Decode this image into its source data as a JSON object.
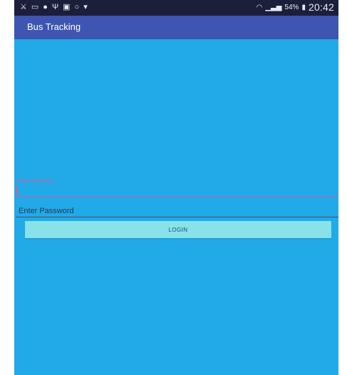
{
  "status_bar": {
    "left_icons": [
      "notification-icon",
      "cast-icon",
      "vpn-icon",
      "usb-icon",
      "gallery-icon",
      "whatsapp-icon",
      "dropdown-icon"
    ],
    "wifi_icon": "wifi-icon",
    "signal_icon": "signal-icon",
    "battery_percent": "54%",
    "battery_icon": "battery-icon",
    "time": "20:42"
  },
  "app_bar": {
    "title": "Bus Tracking"
  },
  "login_form": {
    "username_label": "Enter Username",
    "username_value": "",
    "password_placeholder": "Enter Password",
    "login_label": "LOGIN"
  },
  "colors": {
    "screen_background": "#21aae7",
    "status_bar": "#1b1f3a",
    "app_bar": "#3e55b2",
    "accent": "#e15a9a",
    "button": "#88e2ea"
  }
}
